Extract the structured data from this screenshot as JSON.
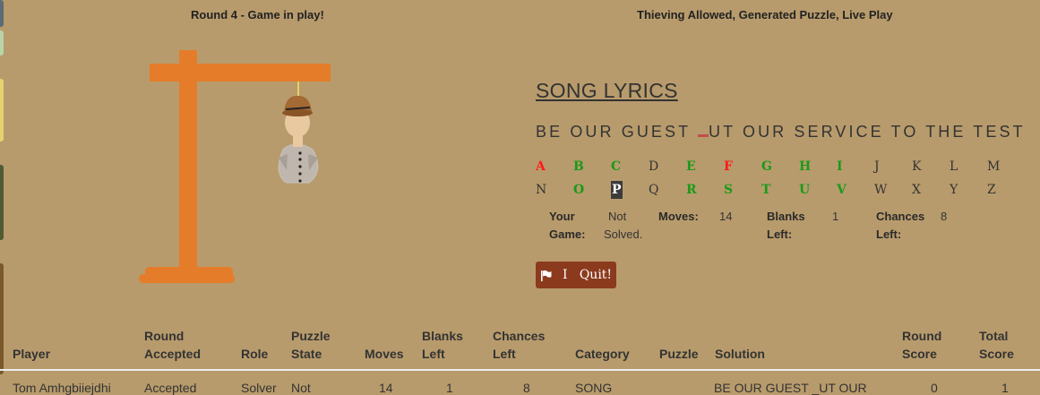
{
  "header": {
    "round_status": "Round 4 - Game in play!",
    "game_mode": "Thieving Allowed, Generated Puzzle, Live Play"
  },
  "category": "SONG LYRICS",
  "puzzle": {
    "before": "BE OUR GUEST ",
    "after": "UT OUR SERVICE TO THE TEST"
  },
  "alphabet": {
    "row1": [
      {
        "l": "A",
        "s": "red"
      },
      {
        "l": "B",
        "s": "green"
      },
      {
        "l": "C",
        "s": "green"
      },
      {
        "l": "D",
        "s": "normal"
      },
      {
        "l": "E",
        "s": "green"
      },
      {
        "l": "F",
        "s": "red"
      },
      {
        "l": "G",
        "s": "green"
      },
      {
        "l": "H",
        "s": "green"
      },
      {
        "l": "I",
        "s": "green"
      },
      {
        "l": "J",
        "s": "normal"
      },
      {
        "l": "K",
        "s": "normal"
      },
      {
        "l": "L",
        "s": "normal"
      },
      {
        "l": "M",
        "s": "normal"
      }
    ],
    "row2": [
      {
        "l": "N",
        "s": "normal"
      },
      {
        "l": "O",
        "s": "green"
      },
      {
        "l": "P",
        "s": "selected"
      },
      {
        "l": "Q",
        "s": "normal"
      },
      {
        "l": "R",
        "s": "green"
      },
      {
        "l": "S",
        "s": "green"
      },
      {
        "l": "T",
        "s": "green"
      },
      {
        "l": "U",
        "s": "green"
      },
      {
        "l": "V",
        "s": "green"
      },
      {
        "l": "W",
        "s": "normal"
      },
      {
        "l": "X",
        "s": "normal"
      },
      {
        "l": "Y",
        "s": "normal"
      },
      {
        "l": "Z",
        "s": "normal"
      }
    ],
    "colors": {
      "red": "#ff1a1a",
      "green": "#1a9a1a"
    }
  },
  "stats": {
    "your_game_label_1": "Your",
    "your_game_label_2": "Game:",
    "your_game_val_1": "Not",
    "your_game_val_2": "Solved.",
    "moves_label": "Moves:",
    "moves_val": "14",
    "blanks_label_1": "Blanks",
    "blanks_label_2": "Left:",
    "blanks_val": "1",
    "chances_label_1": "Chances",
    "chances_label_2": "Left:",
    "chances_val": "8"
  },
  "quit_button": {
    "label": "I   Quit!",
    "icon": "flag-icon"
  },
  "table": {
    "headers": [
      [
        "",
        "Player"
      ],
      [
        "Round",
        "Accepted"
      ],
      [
        "",
        "Role"
      ],
      [
        "Puzzle",
        "State"
      ],
      [
        "",
        "Moves"
      ],
      [
        "Blanks",
        "Left"
      ],
      [
        "Chances",
        "Left"
      ],
      [
        "",
        "Category"
      ],
      [
        "",
        "Puzzle"
      ],
      [
        "",
        "Solution"
      ],
      [
        "Round",
        "Score"
      ],
      [
        "Total",
        "Score"
      ]
    ],
    "row": [
      "Tom Amhgbiiejdhi",
      "Accepted",
      "Solver",
      "Not",
      "14",
      "1",
      "8",
      "SONG",
      "",
      "BE OUR GUEST _UT OUR",
      "0",
      "1"
    ]
  },
  "palette": {
    "background": "#b89b6c",
    "gallows": "#e57c2a",
    "quit": "#8b3a1e"
  }
}
